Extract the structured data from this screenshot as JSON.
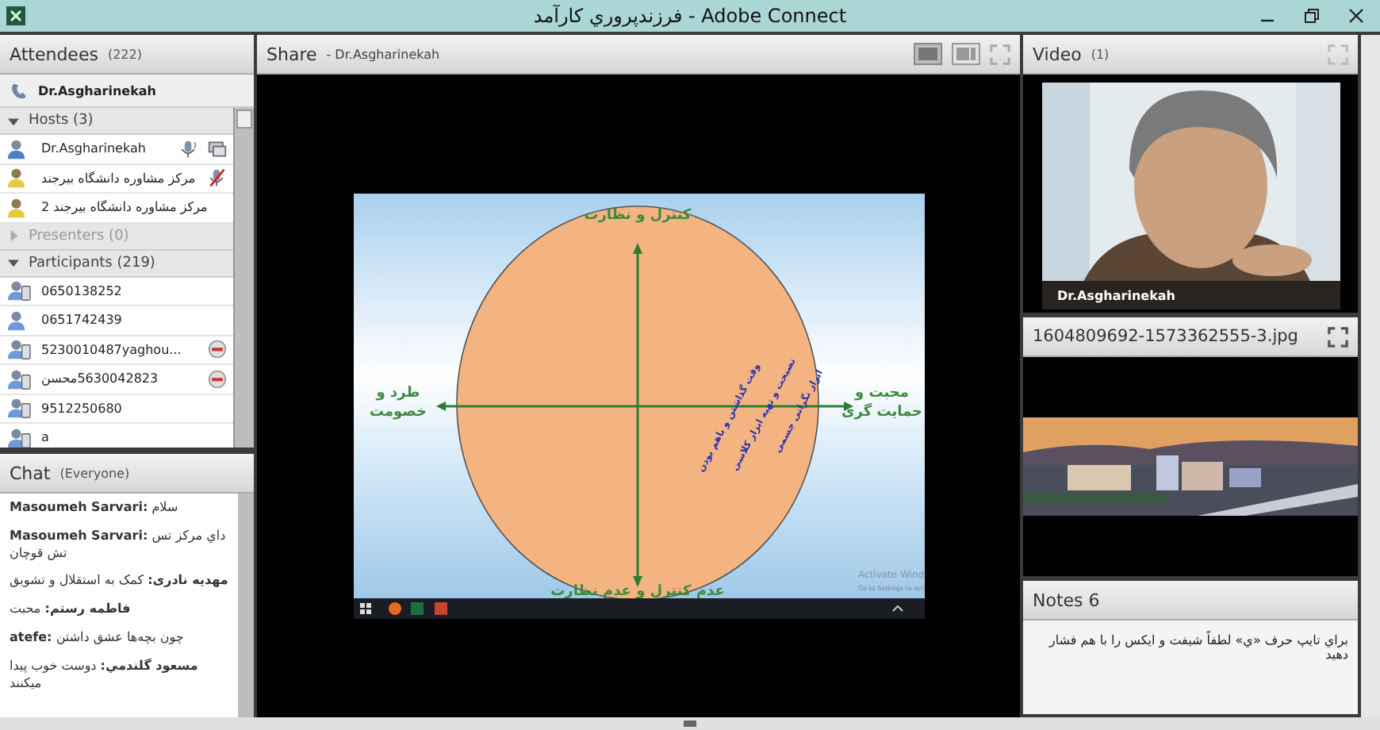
{
  "window": {
    "title": "فرزندپروري كارآمد - Adobe Connect"
  },
  "attendees": {
    "title": "Attendees",
    "count": "(222)",
    "me": {
      "name": "Dr.Asgharinekah"
    },
    "sections": [
      {
        "label": "Hosts (3)",
        "expanded": true,
        "people": [
          {
            "name": "Dr.Asgharinekah",
            "kind": "host",
            "badges": [
              {
                "kind": "mic"
              },
              {
                "kind": "screen"
              }
            ]
          },
          {
            "name": "مركز مشاوره دانشگاه بيرجند",
            "kind": "guest",
            "badges": [
              {
                "kind": "mic-muted"
              }
            ]
          },
          {
            "name": "مركز مشاوره دانشگاه بيرجند 2",
            "kind": "guest"
          }
        ]
      },
      {
        "label": "Presenters (0)",
        "expanded": false
      },
      {
        "label": "Participants (219)",
        "expanded": true,
        "people": [
          {
            "name": "0650138252",
            "kind": "device"
          },
          {
            "name": "0651742439",
            "kind": "plain"
          },
          {
            "name": "5230010487yaghou...",
            "kind": "device",
            "badges": [
              {
                "kind": "remove"
              }
            ]
          },
          {
            "name": "5630042823محسن",
            "kind": "device",
            "badges": [
              {
                "kind": "remove"
              }
            ]
          },
          {
            "name": "9512250680",
            "kind": "device"
          },
          {
            "name": "a",
            "kind": "device"
          }
        ]
      }
    ]
  },
  "chat": {
    "title": "Chat",
    "scope": "(Everyone)",
    "messages": [
      "**Masoumeh Sarvari:** سلام",
      "**Masoumeh Sarvari:** داي مركز تس تش قوچان",
      "**مهدیه نادری:** کمک به استقلال و تشویق",
      "**فاطمه رستم:** محبت",
      "**atefe:** چون بچه‌ها عشق داشتن",
      "**مسعود گلندمي:** دوست خوب پیدا میکنند"
    ]
  },
  "share": {
    "title": "Share",
    "presenter": "- Dr.Asgharinekah",
    "slide": {
      "top": "کنترل و نظارت",
      "bottom": "عدم کنترل و عدم نظارت",
      "left": [
        "طرد و",
        "خصومت"
      ],
      "right": [
        "محبت و",
        "حمایت گری"
      ],
      "notes": [
        "وقت گذاشتن و باهم بودن",
        "نصیحت و تهیه ابزار کلاسی",
        "ابراز نگرانی جسمی"
      ],
      "watermark": [
        "Activate Wind",
        "Go to Settings to act"
      ]
    }
  },
  "video": {
    "title": "Video",
    "count": "(1)",
    "caption": "Dr.Asgharinekah"
  },
  "image_pod": {
    "title": "1604809692-1573362555-3.jpg"
  },
  "notes": {
    "title": "Notes 6",
    "text": "براي تايپ حرف «ي» لطفاً شيفت و ايكس را با هم فشار دهيد"
  }
}
